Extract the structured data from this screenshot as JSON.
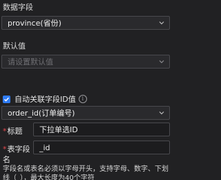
{
  "data_field": {
    "label": "数据字段",
    "value": "province(省份)"
  },
  "default_value": {
    "label": "默认值",
    "placeholder": "请设置默认值"
  },
  "auto_link": {
    "label": "自动关联字段ID值",
    "info_glyph": "i",
    "checked": true
  },
  "link_field": {
    "value": "order_id(订单编号)"
  },
  "title_row": {
    "required_mark": "*",
    "label": "标题",
    "value": "下拉单选ID"
  },
  "table_field_row": {
    "required_mark": "*",
    "label": "表字段",
    "label_wrap": "名",
    "value": "_id"
  },
  "help_text": "字段名或表名必须以字母开头，支持字母、数字、下划线（_），最大长度为40个字符",
  "colors": {
    "accent": "#2f7cf6",
    "required": "#e5484d",
    "background": "#212123"
  },
  "icons": [
    "chevron-down-icon",
    "check-icon",
    "info-icon"
  ]
}
